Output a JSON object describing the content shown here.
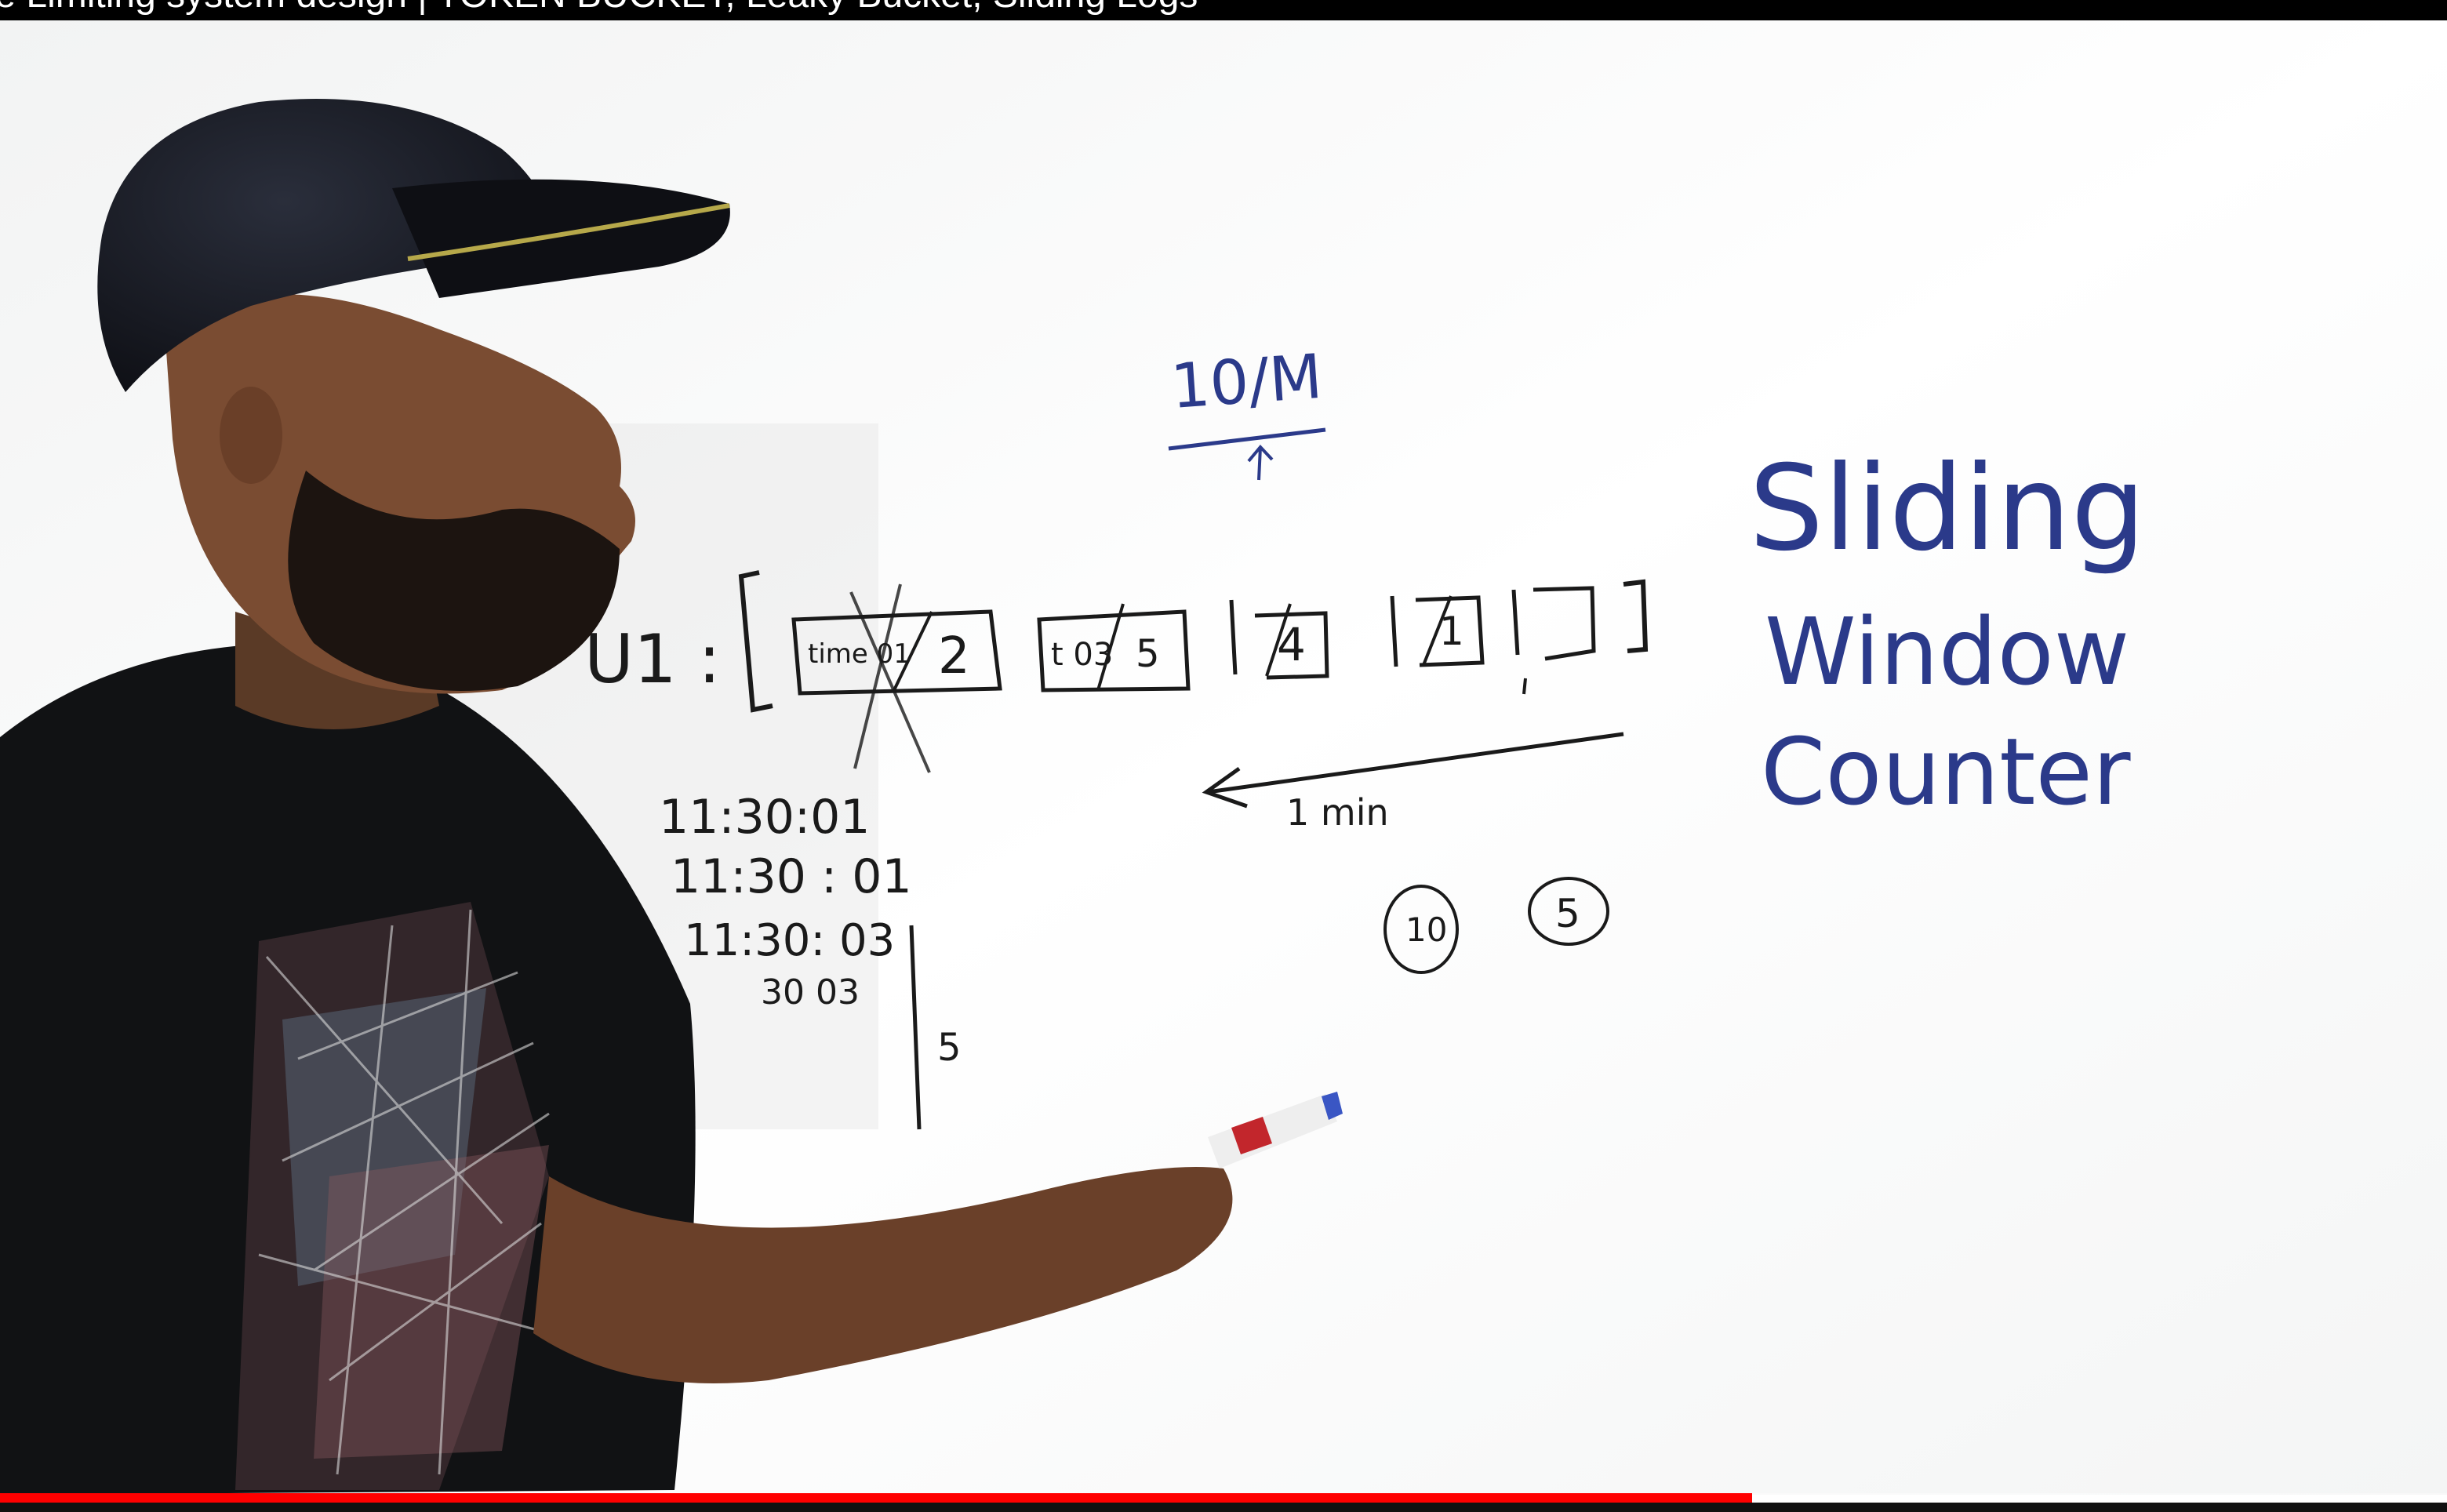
{
  "video": {
    "title": "te Limiting system design | TOKEN BUCKET, Leaky Bucket, Sliding Logs",
    "progress_fraction": 0.716,
    "colors": {
      "progress": "#ff0000",
      "board": "#ffffff",
      "ink_blue": "#2b3a8a",
      "ink_black": "#1a1a1a"
    }
  },
  "whiteboard": {
    "rate": "10/M",
    "label_u1": "U1 :",
    "box1_text": "time 01",
    "box1_count": "2",
    "box2_text": "t 03",
    "box2_count": "5",
    "box3_count": "4",
    "box4_count": "1",
    "window_label": "1 min",
    "timestamps": [
      "11:30:01",
      "11:30 : 01",
      "11:30: 03",
      "30 03"
    ],
    "side_count": "5",
    "circle_a": "10",
    "circle_b": "5",
    "heading": [
      "Sliding",
      "Window",
      "Counter"
    ]
  }
}
